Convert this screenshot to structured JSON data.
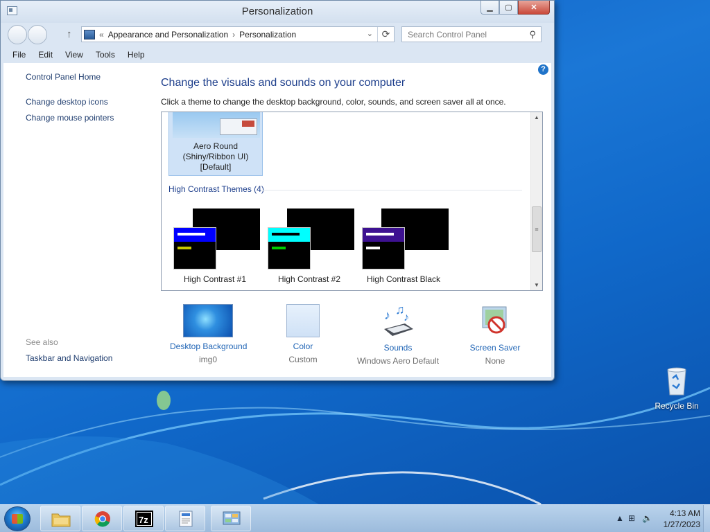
{
  "window": {
    "title": "Personalization",
    "address": {
      "prefix": "«",
      "crumb1": "Appearance and Personalization",
      "separator": "›",
      "crumb2": "Personalization"
    },
    "search_placeholder": "Search Control Panel",
    "menu": [
      "File",
      "Edit",
      "View",
      "Tools",
      "Help"
    ]
  },
  "left_pane": {
    "home": "Control Panel Home",
    "links": [
      "Change desktop icons",
      "Change mouse pointers"
    ],
    "see_also_title": "See also",
    "see_also_links": [
      "Taskbar and Navigation"
    ]
  },
  "main": {
    "title": "Change the visuals and sounds on your computer",
    "description": "Click a theme to change the desktop background, color, sounds, and screen saver all at once.",
    "selected_theme": {
      "line1": "Aero Round",
      "line2": "(Shiny/Ribbon UI)",
      "line3": "[Default]"
    },
    "high_contrast_group": "High Contrast Themes (4)",
    "high_contrast_themes": [
      {
        "label": "High Contrast #1",
        "bar_color": "#0000ff",
        "line_color": "#c8c800"
      },
      {
        "label": "High Contrast #2",
        "bar_color": "#00ffff",
        "line_color": "#00cc00"
      },
      {
        "label": "High Contrast Black",
        "bar_color": "#3d1191",
        "line_color": "#ffffff"
      }
    ]
  },
  "bottom": [
    {
      "label": "Desktop Background",
      "value": "img0",
      "icon": "desktop-background-thumbnail"
    },
    {
      "label": "Color",
      "value": "Custom",
      "icon": "color-swatch"
    },
    {
      "label": "Sounds",
      "value": "Windows Aero Default",
      "icon": "sounds-icon"
    },
    {
      "label": "Screen Saver",
      "value": "None",
      "icon": "screen-saver-icon"
    }
  ],
  "desktop": {
    "recycle_bin": "Recycle Bin"
  },
  "taskbar": {
    "apps": [
      "file-explorer",
      "chrome",
      "7-zip",
      "wordpad",
      "control-panel"
    ],
    "time": "4:13 AM",
    "date": "1/27/2023"
  }
}
